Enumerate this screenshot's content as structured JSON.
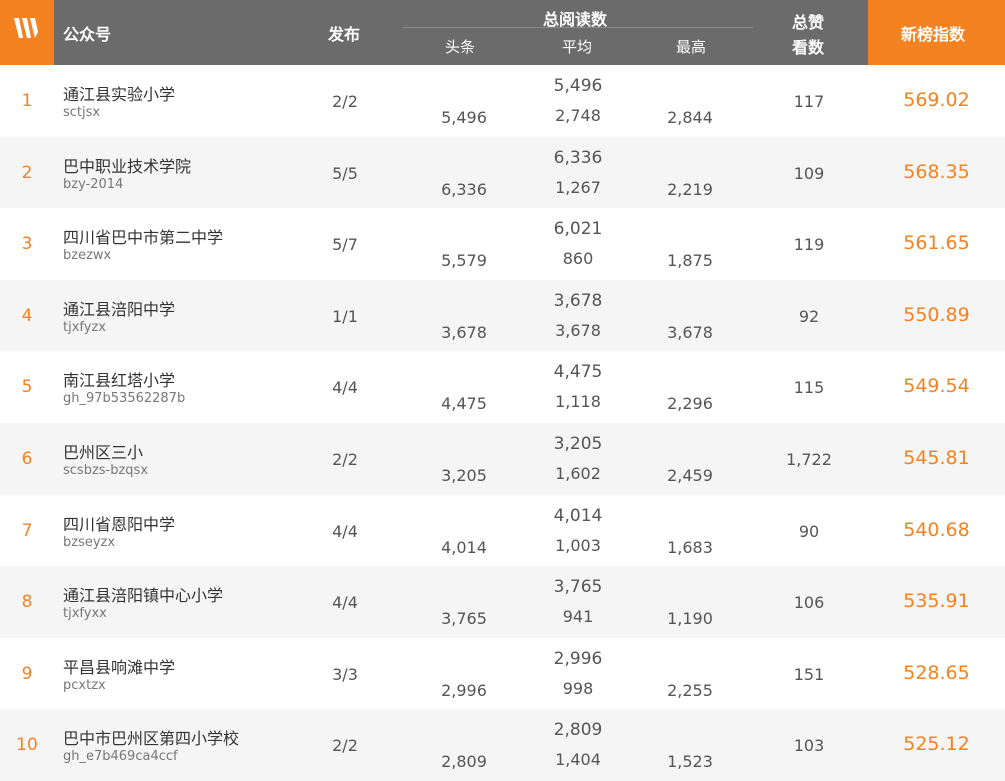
{
  "header": {
    "account": "公众号",
    "publish": "发布",
    "total_reads": "总阅读数",
    "head": "头条",
    "avg": "平均",
    "max": "最高",
    "likes_line1": "总赞",
    "likes_line2": "看数",
    "index": "新榜指数"
  },
  "accent_color": "#f58220",
  "logo_icon": "newrank-logo-icon",
  "rows": [
    {
      "rank": "1",
      "name": "通江县实验小学",
      "account": "sctjsx",
      "publish": "2/2",
      "total": "5,496",
      "head": "5,496",
      "avg": "2,748",
      "max": "2,844",
      "likes": "117",
      "score": "569.02"
    },
    {
      "rank": "2",
      "name": "巴中职业技术学院",
      "account": "bzy-2014",
      "publish": "5/5",
      "total": "6,336",
      "head": "6,336",
      "avg": "1,267",
      "max": "2,219",
      "likes": "109",
      "score": "568.35"
    },
    {
      "rank": "3",
      "name": "四川省巴中市第二中学",
      "account": "bzezwx",
      "publish": "5/7",
      "total": "6,021",
      "head": "5,579",
      "avg": "860",
      "max": "1,875",
      "likes": "119",
      "score": "561.65"
    },
    {
      "rank": "4",
      "name": "通江县涪阳中学",
      "account": "tjxfyzx",
      "publish": "1/1",
      "total": "3,678",
      "head": "3,678",
      "avg": "3,678",
      "max": "3,678",
      "likes": "92",
      "score": "550.89"
    },
    {
      "rank": "5",
      "name": "南江县红塔小学",
      "account": "gh_97b53562287b",
      "publish": "4/4",
      "total": "4,475",
      "head": "4,475",
      "avg": "1,118",
      "max": "2,296",
      "likes": "115",
      "score": "549.54"
    },
    {
      "rank": "6",
      "name": "巴州区三小",
      "account": "scsbzs-bzqsx",
      "publish": "2/2",
      "total": "3,205",
      "head": "3,205",
      "avg": "1,602",
      "max": "2,459",
      "likes": "1,722",
      "score": "545.81"
    },
    {
      "rank": "7",
      "name": "四川省恩阳中学",
      "account": "bzseyzx",
      "publish": "4/4",
      "total": "4,014",
      "head": "4,014",
      "avg": "1,003",
      "max": "1,683",
      "likes": "90",
      "score": "540.68"
    },
    {
      "rank": "8",
      "name": "通江县涪阳镇中心小学",
      "account": "tjxfyxx",
      "publish": "4/4",
      "total": "3,765",
      "head": "3,765",
      "avg": "941",
      "max": "1,190",
      "likes": "106",
      "score": "535.91"
    },
    {
      "rank": "9",
      "name": "平昌县响滩中学",
      "account": "pcxtzx",
      "publish": "3/3",
      "total": "2,996",
      "head": "2,996",
      "avg": "998",
      "max": "2,255",
      "likes": "151",
      "score": "528.65"
    },
    {
      "rank": "10",
      "name": "巴中市巴州区第四小学校",
      "account": "gh_e7b469ca4ccf",
      "publish": "2/2",
      "total": "2,809",
      "head": "2,809",
      "avg": "1,404",
      "max": "1,523",
      "likes": "103",
      "score": "525.12"
    }
  ]
}
